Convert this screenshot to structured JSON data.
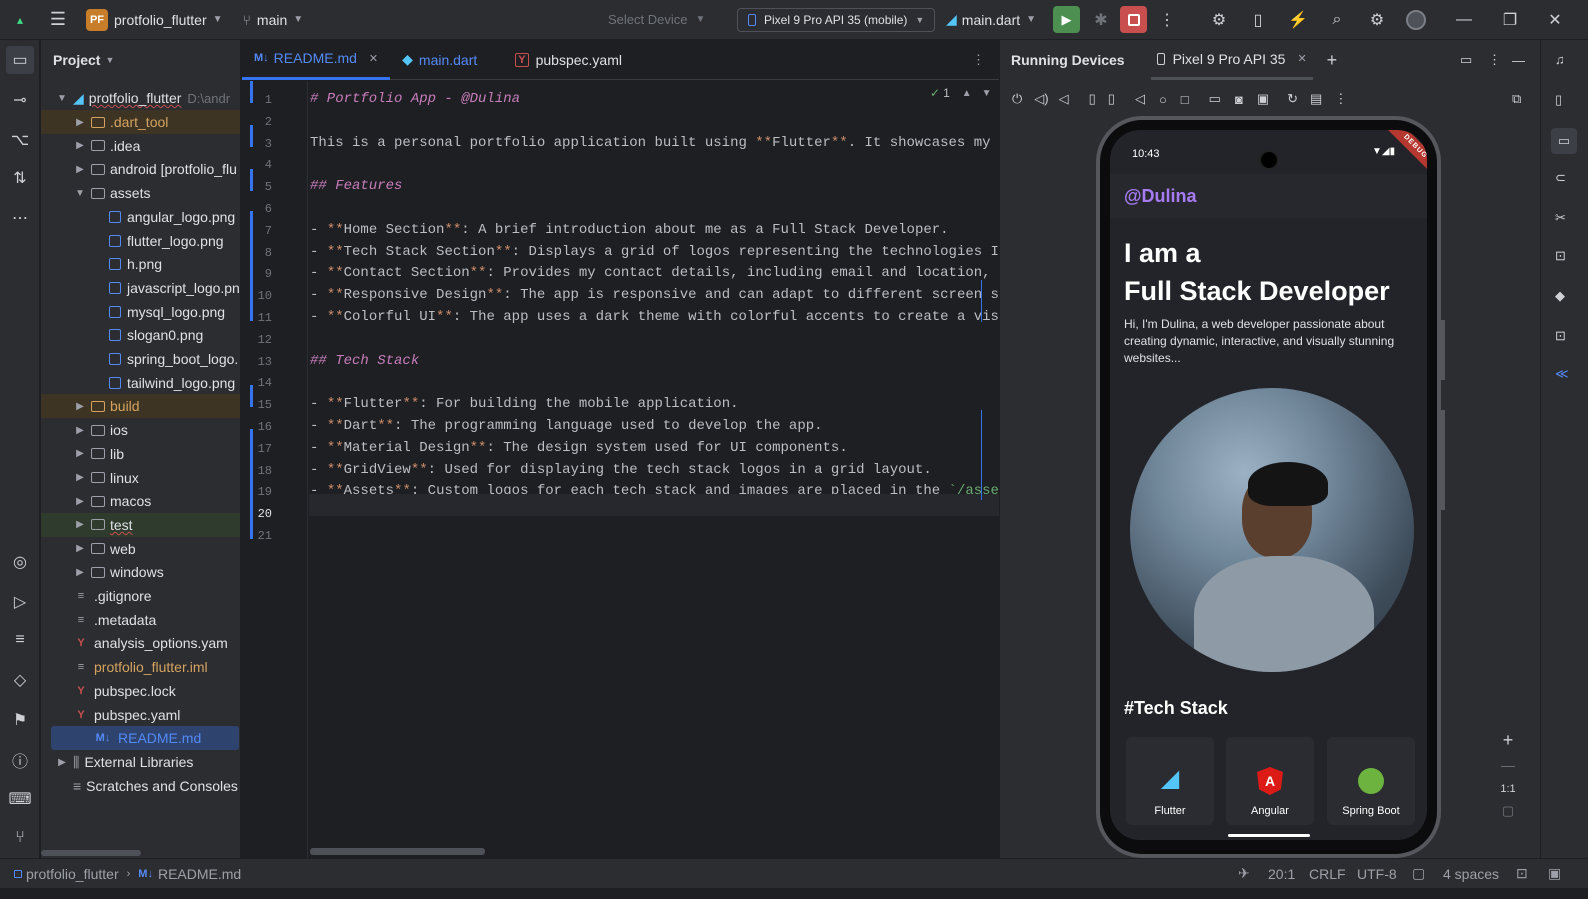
{
  "titlebar": {
    "project_badge": "PF",
    "project_name": "protfolio_flutter",
    "branch": "main",
    "select_device": "Select Device",
    "device": "Pixel 9 Pro API 35 (mobile)",
    "run_config": "main.dart"
  },
  "project_panel": {
    "title": "Project",
    "root_name": "protfolio_flutter",
    "root_path": "D:\\andr",
    "items": [
      {
        "label": ".dart_tool",
        "type": "folder",
        "color": "#d5a35f"
      },
      {
        "label": ".idea",
        "type": "folder",
        "color": "#dfe1e5"
      },
      {
        "label": "android [protfolio_flu",
        "type": "folder",
        "color": "#dfe1e5"
      },
      {
        "label": "assets",
        "type": "folder-open",
        "color": "#dfe1e5"
      },
      {
        "label": "angular_logo.png",
        "type": "image",
        "color": "#dfe1e5"
      },
      {
        "label": "flutter_logo.png",
        "type": "image",
        "color": "#dfe1e5"
      },
      {
        "label": "h.png",
        "type": "image",
        "color": "#dfe1e5"
      },
      {
        "label": "javascript_logo.pn",
        "type": "image",
        "color": "#dfe1e5"
      },
      {
        "label": "mysql_logo.png",
        "type": "image",
        "color": "#dfe1e5"
      },
      {
        "label": "slogan0.png",
        "type": "image",
        "color": "#dfe1e5"
      },
      {
        "label": "spring_boot_logo.",
        "type": "image",
        "color": "#dfe1e5"
      },
      {
        "label": "tailwind_logo.png",
        "type": "image",
        "color": "#dfe1e5"
      },
      {
        "label": "build",
        "type": "folder",
        "color": "#d5a35f"
      },
      {
        "label": "ios",
        "type": "folder",
        "color": "#dfe1e5"
      },
      {
        "label": "lib",
        "type": "folder",
        "color": "#dfe1e5"
      },
      {
        "label": "linux",
        "type": "folder",
        "color": "#dfe1e5"
      },
      {
        "label": "macos",
        "type": "folder",
        "color": "#dfe1e5"
      },
      {
        "label": "test",
        "type": "folder",
        "color": "#dfe1e5"
      },
      {
        "label": "web",
        "type": "folder",
        "color": "#dfe1e5"
      },
      {
        "label": "windows",
        "type": "folder",
        "color": "#dfe1e5"
      },
      {
        "label": ".gitignore",
        "type": "file",
        "color": "#dfe1e5"
      },
      {
        "label": ".metadata",
        "type": "file",
        "color": "#dfe1e5"
      },
      {
        "label": "analysis_options.yam",
        "type": "yaml",
        "color": "#dfe1e5"
      },
      {
        "label": "protfolio_flutter.iml",
        "type": "file",
        "color": "#d5a35f"
      },
      {
        "label": "pubspec.lock",
        "type": "yaml",
        "color": "#dfe1e5"
      },
      {
        "label": "pubspec.yaml",
        "type": "yaml",
        "color": "#dfe1e5"
      },
      {
        "label": "README.md",
        "type": "md",
        "color": "#548af7"
      }
    ],
    "external_libraries": "External Libraries",
    "scratches": "Scratches and Consoles"
  },
  "editor": {
    "tabs": [
      {
        "label": "README.md",
        "icon": "M↓"
      },
      {
        "label": "main.dart",
        "icon": "dart"
      },
      {
        "label": "pubspec.yaml",
        "icon": "Y"
      }
    ],
    "inspection_count": "1",
    "lines": [
      {
        "n": "1",
        "text": "# Portfolio App - @Dulina",
        "kind": "h"
      },
      {
        "n": "2",
        "text": "",
        "kind": "t"
      },
      {
        "n": "3",
        "text": "This is a personal portfolio application built using **Flutter**. It showcases my skill",
        "kind": "t"
      },
      {
        "n": "4",
        "text": "",
        "kind": "t"
      },
      {
        "n": "5",
        "text": "## Features",
        "kind": "h"
      },
      {
        "n": "6",
        "text": "",
        "kind": "t"
      },
      {
        "n": "7",
        "text": "- **Home Section**: A brief introduction about me as a Full Stack Developer.",
        "kind": "t"
      },
      {
        "n": "8",
        "text": "- **Tech Stack Section**: Displays a grid of logos representing the technologies I work",
        "kind": "t"
      },
      {
        "n": "9",
        "text": "- **Contact Section**: Provides my contact details, including email and location, with",
        "kind": "t"
      },
      {
        "n": "10",
        "text": "- **Responsive Design**: The app is responsive and can adapt to different screen sizes.",
        "kind": "t"
      },
      {
        "n": "11",
        "text": "- **Colorful UI**: The app uses a dark theme with colorful accents to create a visually",
        "kind": "t"
      },
      {
        "n": "12",
        "text": "",
        "kind": "t"
      },
      {
        "n": "13",
        "text": "## Tech Stack",
        "kind": "h"
      },
      {
        "n": "14",
        "text": "",
        "kind": "t"
      },
      {
        "n": "15",
        "text": "- **Flutter**: For building the mobile application.",
        "kind": "t"
      },
      {
        "n": "16",
        "text": "- **Dart**: The programming language used to develop the app.",
        "kind": "t"
      },
      {
        "n": "17",
        "text": "- **Material Design**: The design system used for UI components.",
        "kind": "t"
      },
      {
        "n": "18",
        "text": "- **GridView**: Used for displaying the tech stack logos in a grid layout.",
        "kind": "t"
      },
      {
        "n": "19",
        "text": "- **Assets**: Custom logos for each tech stack and images are placed in the `/assets` f",
        "kind": "t"
      },
      {
        "n": "20",
        "text": "",
        "kind": "t"
      },
      {
        "n": "21",
        "text": "",
        "kind": "t"
      }
    ]
  },
  "devices": {
    "title": "Running Devices",
    "tab": "Pixel 9 Pro API 35",
    "zoom_label": "1:1",
    "phone": {
      "time": "10:43",
      "debug_ribbon": "DEBUG",
      "handle": "@Dulina",
      "headline_1": "I am a",
      "headline_2": "Full Stack Developer",
      "intro": "Hi, I'm Dulina, a web developer passionate about creating dynamic, interactive, and visually stunning websites...",
      "tech_title": "#Tech Stack",
      "tech_items": [
        "Flutter",
        "Angular",
        "Spring Boot"
      ]
    }
  },
  "statusbar": {
    "crumb_project": "protfolio_flutter",
    "crumb_file": "README.md",
    "position": "20:1",
    "line_sep": "CRLF",
    "encoding": "UTF-8",
    "indent": "4 spaces"
  },
  "colors": {
    "accent": "#3574f0",
    "run_green": "#499c54",
    "stop_red": "#db5c5c",
    "handle_purple": "#a77bf3"
  }
}
